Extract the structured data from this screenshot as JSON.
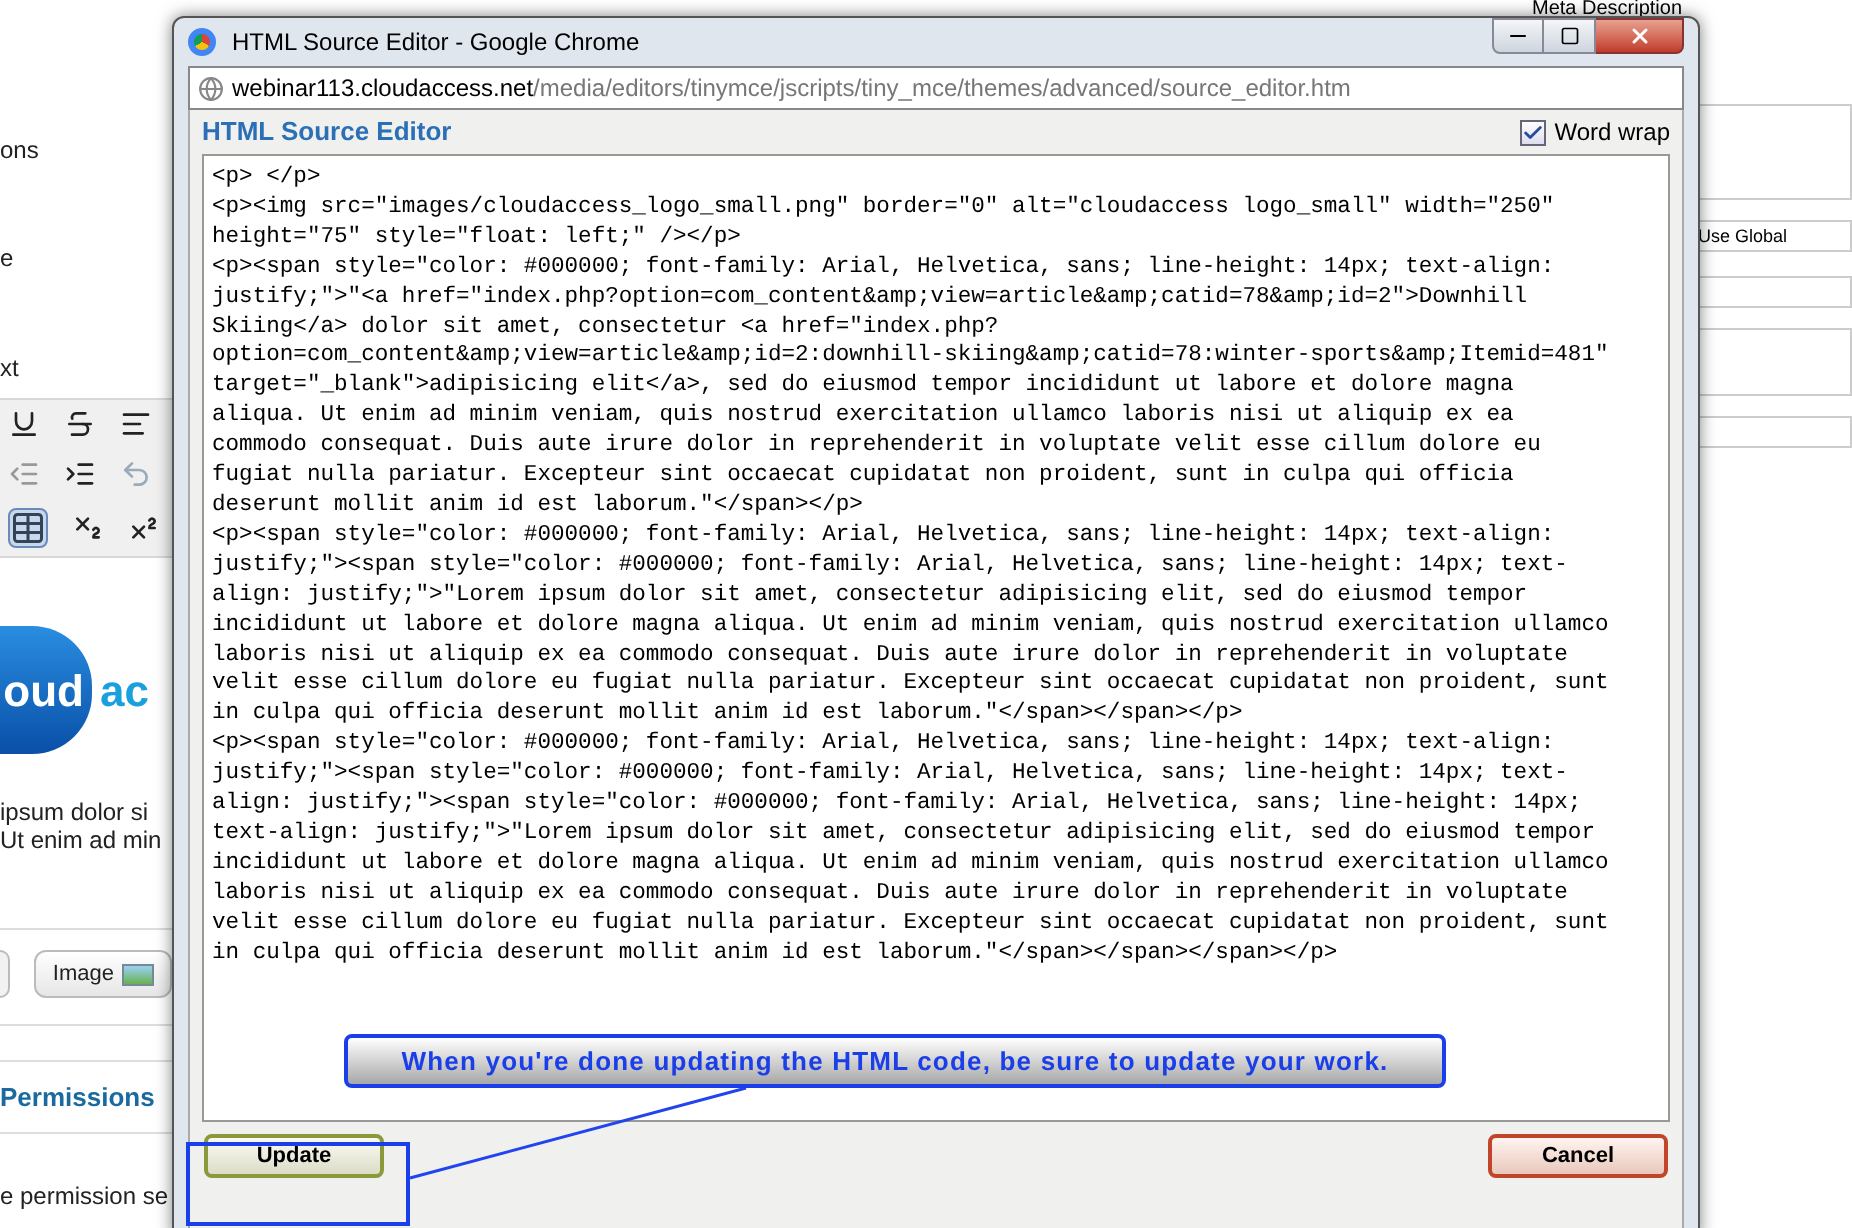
{
  "background_page": {
    "left_labels": [
      "ons",
      "e",
      "xt"
    ],
    "logo": {
      "word_a": "oud",
      "word_b": "ac"
    },
    "body_lines": [
      "ipsum dolor si",
      "Ut enim ad min"
    ],
    "image_button": "Image",
    "section_title": "Permissions",
    "section_text": "e permission se",
    "meta_label": "Meta Description",
    "select_value": "Use Global"
  },
  "popup": {
    "title": "HTML Source Editor - Google Chrome",
    "url_host": "webinar113.cloudaccess.net",
    "url_path": "/media/editors/tinymce/jscripts/tiny_mce/themes/advanced/source_editor.htm",
    "heading": "HTML Source Editor",
    "word_wrap": {
      "label": "Word wrap",
      "checked": true
    },
    "source_lines": [
      "<p> </p>",
      "<p><img src=\"images/cloudaccess_logo_small.png\" border=\"0\" alt=\"cloudaccess logo_small\" width=\"250\"",
      "height=\"75\" style=\"float: left;\" /></p>",
      "<p><span style=\"color: #000000; font-family: Arial, Helvetica, sans; line-height: 14px; text-align:",
      "justify;\">\"<a href=\"index.php?option=com_content&amp;view=article&amp;catid=78&amp;id=2\">Downhill",
      "Skiing</a> dolor sit amet, consectetur <a href=\"index.php?",
      "option=com_content&amp;view=article&amp;id=2:downhill-skiing&amp;catid=78:winter-sports&amp;Itemid=481\"",
      "target=\"_blank\">adipisicing elit</a>, sed do eiusmod tempor incididunt ut labore et dolore magna",
      "aliqua. Ut enim ad minim veniam, quis nostrud exercitation ullamco laboris nisi ut aliquip ex ea",
      "commodo consequat. Duis aute irure dolor in reprehenderit in voluptate velit esse cillum dolore eu",
      "fugiat nulla pariatur. Excepteur sint occaecat cupidatat non proident, sunt in culpa qui officia",
      "deserunt mollit anim id est laborum.\"</span></p>",
      "<p><span style=\"color: #000000; font-family: Arial, Helvetica, sans; line-height: 14px; text-align:",
      "justify;\"><span style=\"color: #000000; font-family: Arial, Helvetica, sans; line-height: 14px; text-",
      "align: justify;\">\"Lorem ipsum dolor sit amet, consectetur adipisicing elit, sed do eiusmod tempor",
      "incididunt ut labore et dolore magna aliqua. Ut enim ad minim veniam, quis nostrud exercitation ullamco",
      "laboris nisi ut aliquip ex ea commodo consequat. Duis aute irure dolor in reprehenderit in voluptate",
      "velit esse cillum dolore eu fugiat nulla pariatur. Excepteur sint occaecat cupidatat non proident, sunt",
      "in culpa qui officia deserunt mollit anim id est laborum.\"</span></span></p>",
      "<p><span style=\"color: #000000; font-family: Arial, Helvetica, sans; line-height: 14px; text-align:",
      "justify;\"><span style=\"color: #000000; font-family: Arial, Helvetica, sans; line-height: 14px; text-",
      "align: justify;\"><span style=\"color: #000000; font-family: Arial, Helvetica, sans; line-height: 14px;",
      "text-align: justify;\">\"Lorem ipsum dolor sit amet, consectetur adipisicing elit, sed do eiusmod tempor",
      "incididunt ut labore et dolore magna aliqua. Ut enim ad minim veniam, quis nostrud exercitation ullamco",
      "laboris nisi ut aliquip ex ea commodo consequat. Duis aute irure dolor in reprehenderit in voluptate",
      "velit esse cillum dolore eu fugiat nulla pariatur. Excepteur sint occaecat cupidatat non proident, sunt",
      "in culpa qui officia deserunt mollit anim id est laborum.\"</span></span></span></p>"
    ],
    "buttons": [
      {
        "label": "Update",
        "kind": "update"
      },
      {
        "label": "Cancel",
        "kind": "cancel"
      }
    ]
  },
  "callout": {
    "text": "When you're done updating the HTML code, be sure to update your work."
  }
}
